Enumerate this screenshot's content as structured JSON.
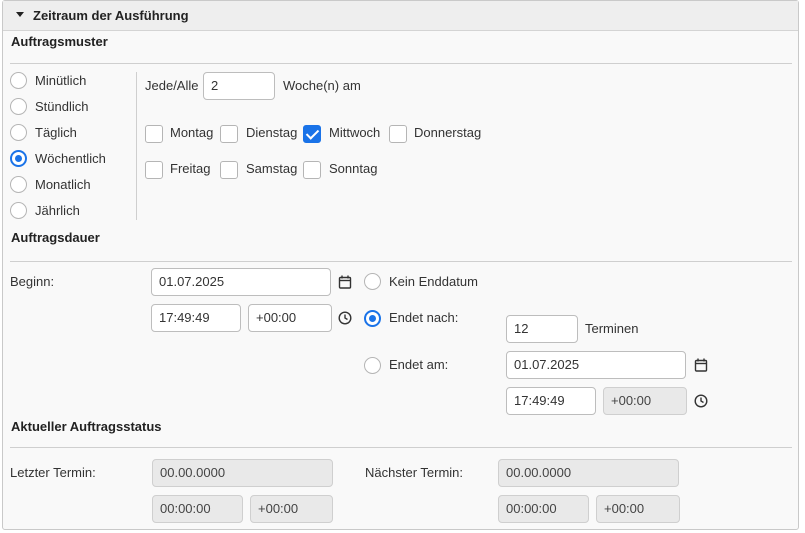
{
  "header": {
    "title": "Zeitraum der Ausführung"
  },
  "pattern": {
    "title": "Auftragsmuster",
    "options": [
      "Minütlich",
      "Stündlich",
      "Täglich",
      "Wöchentlich",
      "Monatlich",
      "Jährlich"
    ],
    "selected": "Wöchentlich",
    "every_label": "Jede/Alle",
    "every_value": "2",
    "unit_label": "Woche(n) am",
    "days": [
      {
        "label": "Montag",
        "checked": false
      },
      {
        "label": "Dienstag",
        "checked": false
      },
      {
        "label": "Mittwoch",
        "checked": true
      },
      {
        "label": "Donnerstag",
        "checked": false
      },
      {
        "label": "Freitag",
        "checked": false
      },
      {
        "label": "Samstag",
        "checked": false
      },
      {
        "label": "Sonntag",
        "checked": false
      }
    ]
  },
  "duration": {
    "title": "Auftragsdauer",
    "begin_label": "Beginn:",
    "begin_date": "01.07.2025",
    "begin_time": "17:49:49",
    "begin_tz": "+00:00",
    "no_end_label": "Kein Enddatum",
    "ends_after_label": "Endet nach:",
    "ends_after_value": "12",
    "ends_after_unit": "Terminen",
    "ends_on_label": "Endet am:",
    "end_date": "01.07.2025",
    "end_time": "17:49:49",
    "end_tz": "+00:00",
    "selected": "Endet nach:",
    "icons": {
      "calendar": "calendar-icon",
      "clock": "clock-icon"
    }
  },
  "status": {
    "title": "Aktueller Auftragsstatus",
    "last_label": "Letzter Termin:",
    "last_date": "00.00.0000",
    "last_time": "00:00:00",
    "last_tz": "+00:00",
    "next_label": "Nächster Termin:",
    "next_date": "00.00.0000",
    "next_time": "00:00:00",
    "next_tz": "+00:00"
  },
  "colors": {
    "accent": "#1a73e8",
    "header_bg": "#eeeeee",
    "panel_bg": "#f9f9f9",
    "disabled_bg": "#e9e9e9"
  }
}
